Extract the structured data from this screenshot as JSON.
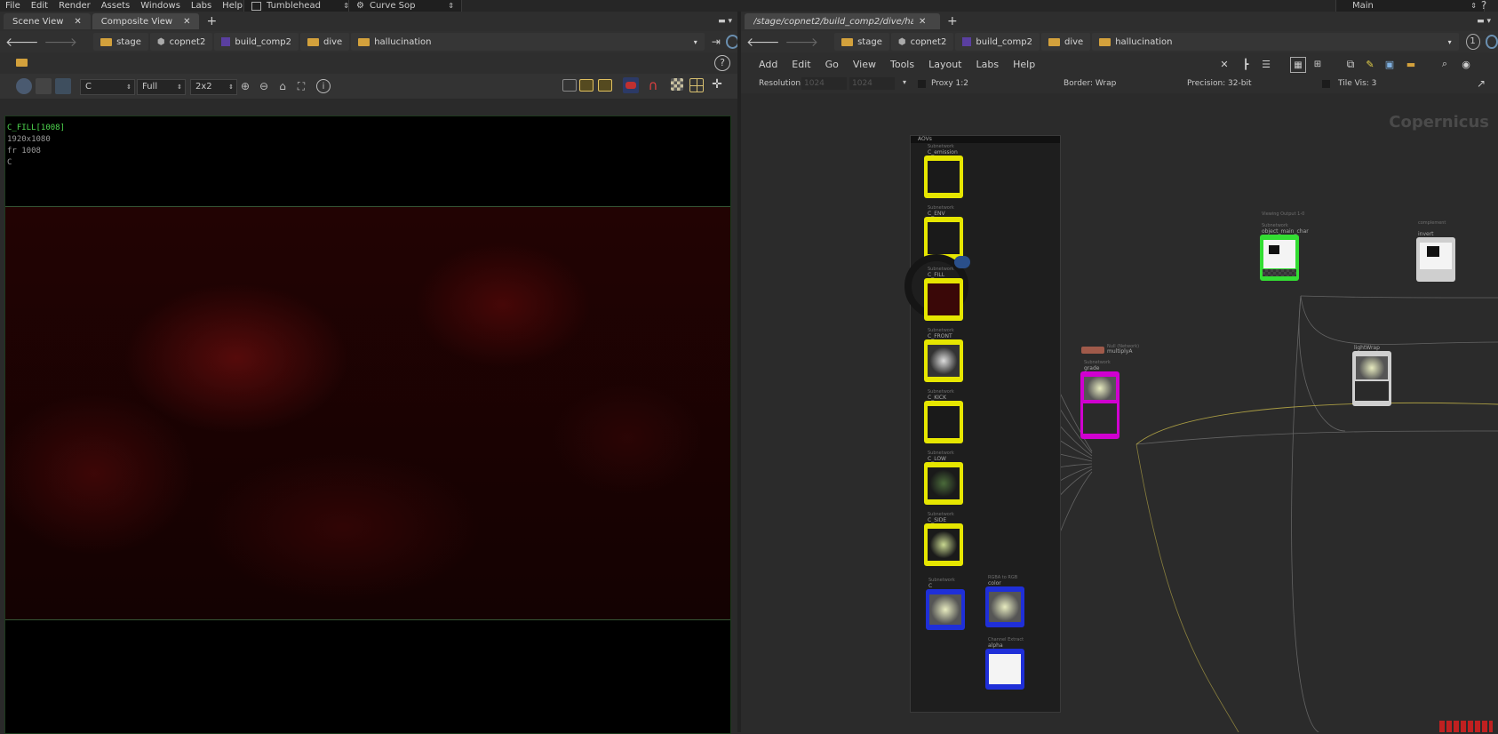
{
  "menubar": {
    "items": [
      "File",
      "Edit",
      "Render",
      "Assets",
      "Windows",
      "Labs",
      "Help"
    ],
    "desktop": "Tumblehead",
    "context": "Curve Sop",
    "right_desktop": "Main"
  },
  "left_pane": {
    "tabs": [
      "Scene View",
      "Composite View"
    ],
    "breadcrumbs": [
      "stage",
      "copnet2",
      "build_comp2",
      "dive",
      "hallucination"
    ],
    "toolbar": {
      "channel": "C",
      "resolution": "Full",
      "tiles": "2x2"
    },
    "overlay": {
      "name": "C_FILL[1008]",
      "size": "1920x1080",
      "frame": "fr 1008",
      "plane": "C"
    }
  },
  "right_pane": {
    "path_tab": "/stage/copnet2/build_comp2/dive/hallucinati...",
    "breadcrumbs": [
      "stage",
      "copnet2",
      "build_comp2",
      "dive",
      "hallucination"
    ],
    "menu": [
      "Add",
      "Edit",
      "Go",
      "View",
      "Tools",
      "Layout",
      "Labs",
      "Help"
    ],
    "status": {
      "resolution_label": "Resolution",
      "res_w": "1024",
      "res_h": "1024",
      "proxy": "Proxy 1:2",
      "border": "Border: Wrap",
      "precision": "Precision: 32-bit",
      "tile_vis": "Tile Vis: 3"
    },
    "watermark": "Copernicus",
    "page_number": "1"
  },
  "network": {
    "box_label": "AOVs",
    "nodes": [
      {
        "name": "C_emission",
        "type": "Subnetwork",
        "color": "#e6e600"
      },
      {
        "name": "C_ENV",
        "type": "Subnetwork",
        "color": "#e6e600"
      },
      {
        "name": "C_FILL",
        "type": "Subnetwork",
        "color": "#e6e600"
      },
      {
        "name": "C_FRONT",
        "type": "Subnetwork",
        "color": "#e6e600"
      },
      {
        "name": "C_KICK",
        "type": "Subnetwork",
        "color": "#e6e600"
      },
      {
        "name": "C_LOW",
        "type": "Subnetwork",
        "color": "#e6e600"
      },
      {
        "name": "C_SIDE",
        "type": "Subnetwork",
        "color": "#e6e600"
      },
      {
        "name": "C",
        "type": "Subnetwork",
        "color": "#1f2fd8"
      },
      {
        "name": "color",
        "type": "RGBA to RGB",
        "color": "#1f2fd8"
      },
      {
        "name": "alpha",
        "type": "Channel Extract",
        "color": "#1f2fd8"
      },
      {
        "name": "grade",
        "type": "Subnetwork",
        "color": "#d000d0"
      },
      {
        "name": "multiplyA",
        "type": "Null (Network)",
        "color": "#a05a4a"
      },
      {
        "name": "object_main_char",
        "type": "Subnetwork",
        "color": "#33dd33"
      },
      {
        "name": "Viewing Output 1-0",
        "type": "",
        "color": ""
      },
      {
        "name": "invert",
        "type": "complement",
        "color": "#cfcfcf"
      },
      {
        "name": "lightWrap",
        "type": "",
        "color": "#cfcfcf"
      }
    ]
  },
  "colors": {
    "yellow_node": "#e6e600",
    "blue_node": "#1f2fd8",
    "magenta_node": "#d000d0",
    "green_node": "#33dd33",
    "overlay_green": "#4fd84f",
    "viewer_tint": "#3a0505"
  }
}
